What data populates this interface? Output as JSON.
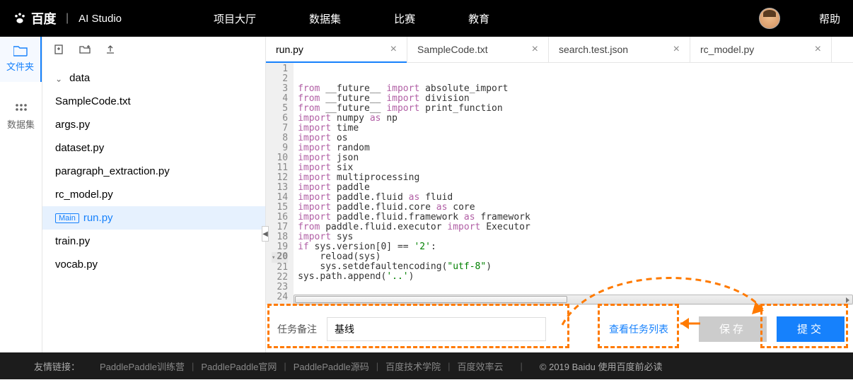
{
  "header": {
    "brand_main": "百度",
    "brand_sub": "AI Studio",
    "nav": [
      "项目大厅",
      "数据集",
      "比赛",
      "教育"
    ],
    "help": "帮助"
  },
  "left_tabs": {
    "files": "文件夹",
    "datasets": "数据集"
  },
  "tree": {
    "folder": "data",
    "items": [
      "SampleCode.txt",
      "args.py",
      "dataset.py",
      "paragraph_extraction.py",
      "rc_model.py",
      "run.py",
      "train.py",
      "vocab.py"
    ],
    "main_badge": "Main",
    "selected": "run.py"
  },
  "tabs": [
    {
      "label": "run.py",
      "active": true
    },
    {
      "label": "SampleCode.txt",
      "active": false
    },
    {
      "label": "search.test.json",
      "active": false
    },
    {
      "label": "rc_model.py",
      "active": false
    }
  ],
  "code_lines": [
    [
      [
        "kw",
        "from"
      ],
      [
        "",
        " __future__ "
      ],
      [
        "kw",
        "import"
      ],
      [
        "",
        " absolute_import"
      ]
    ],
    [
      [
        "kw",
        "from"
      ],
      [
        "",
        " __future__ "
      ],
      [
        "kw",
        "import"
      ],
      [
        "",
        " division"
      ]
    ],
    [
      [
        "kw",
        "from"
      ],
      [
        "",
        " __future__ "
      ],
      [
        "kw",
        "import"
      ],
      [
        "",
        " print_function"
      ]
    ],
    [
      [
        "",
        ""
      ]
    ],
    [
      [
        "kw",
        "import"
      ],
      [
        "",
        " numpy "
      ],
      [
        "kw",
        "as"
      ],
      [
        "",
        " np"
      ]
    ],
    [
      [
        "kw",
        "import"
      ],
      [
        "",
        " time"
      ]
    ],
    [
      [
        "kw",
        "import"
      ],
      [
        "",
        " os"
      ]
    ],
    [
      [
        "kw",
        "import"
      ],
      [
        "",
        " random"
      ]
    ],
    [
      [
        "kw",
        "import"
      ],
      [
        "",
        " json"
      ]
    ],
    [
      [
        "kw",
        "import"
      ],
      [
        "",
        " six"
      ]
    ],
    [
      [
        "kw",
        "import"
      ],
      [
        "",
        " multiprocessing"
      ]
    ],
    [
      [
        "",
        ""
      ]
    ],
    [
      [
        "kw",
        "import"
      ],
      [
        "",
        " paddle"
      ]
    ],
    [
      [
        "kw",
        "import"
      ],
      [
        "",
        " paddle.fluid "
      ],
      [
        "kw",
        "as"
      ],
      [
        "",
        " fluid"
      ]
    ],
    [
      [
        "kw",
        "import"
      ],
      [
        "",
        " paddle.fluid.core "
      ],
      [
        "kw",
        "as"
      ],
      [
        "",
        " core"
      ]
    ],
    [
      [
        "kw",
        "import"
      ],
      [
        "",
        " paddle.fluid.framework "
      ],
      [
        "kw",
        "as"
      ],
      [
        "",
        " framework"
      ]
    ],
    [
      [
        "kw",
        "from"
      ],
      [
        "",
        " paddle.fluid.executor "
      ],
      [
        "kw",
        "import"
      ],
      [
        "",
        " Executor"
      ]
    ],
    [
      [
        "",
        ""
      ]
    ],
    [
      [
        "kw",
        "import"
      ],
      [
        "",
        " sys"
      ]
    ],
    [
      [
        "kw",
        "if"
      ],
      [
        "",
        " sys.version[0] == "
      ],
      [
        "str",
        "'2'"
      ],
      [
        "",
        ":"
      ]
    ],
    [
      [
        "",
        "    reload(sys)"
      ]
    ],
    [
      [
        "",
        "    sys.setdefaultencoding("
      ],
      [
        "str",
        "\"utf-8\""
      ],
      [
        "",
        ")"
      ]
    ],
    [
      [
        "",
        "sys.path.append("
      ],
      [
        "str",
        "'..'"
      ],
      [
        "",
        ")"
      ]
    ],
    [
      [
        "",
        ""
      ]
    ]
  ],
  "current_line": 20,
  "action": {
    "task_label": "任务备注",
    "task_value": "基线",
    "view_list": "查看任务列表",
    "save": "保存",
    "submit": "提交"
  },
  "footer": {
    "label": "友情链接：",
    "links": [
      "PaddlePaddle训练营",
      "PaddlePaddle官网",
      "PaddlePaddle源码",
      "百度技术学院",
      "百度效率云"
    ],
    "copyright": "© 2019 Baidu 使用百度前必读"
  }
}
